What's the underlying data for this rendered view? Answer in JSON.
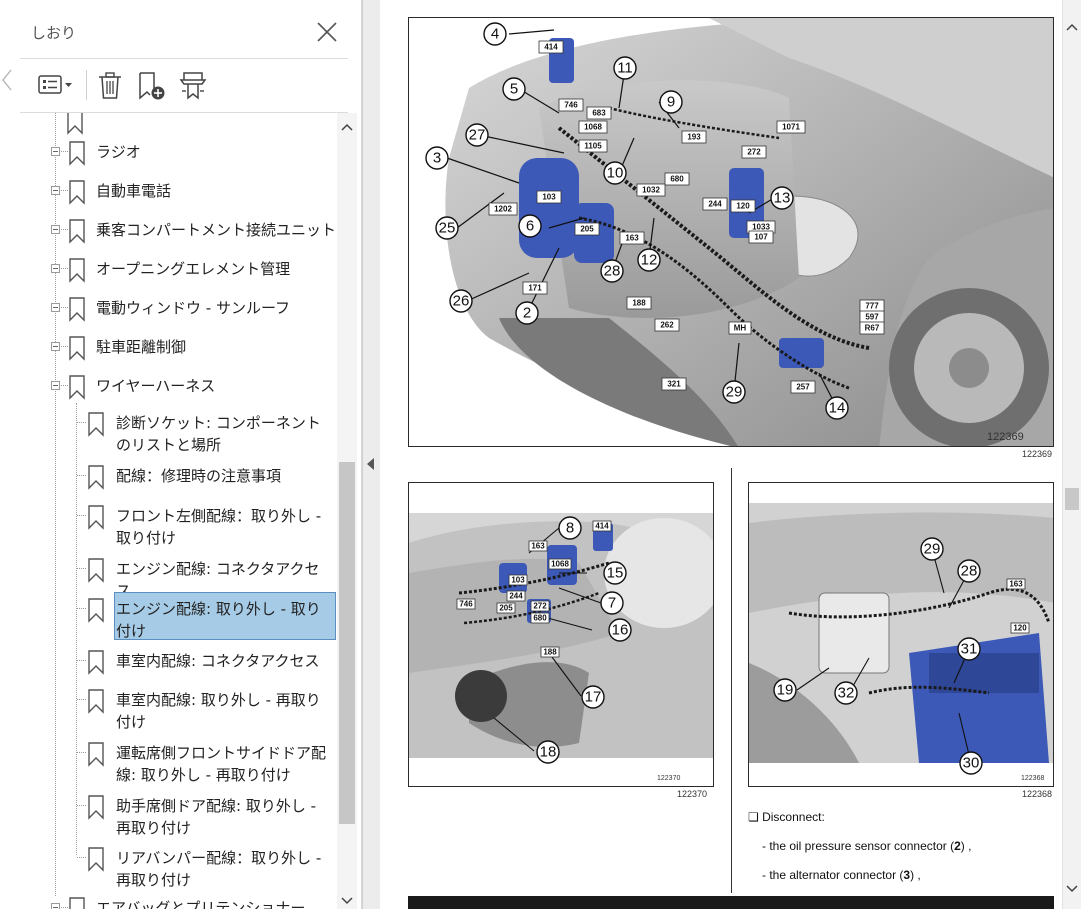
{
  "panel": {
    "title": "しおり",
    "toolbar": {
      "options_icon": "bookmark-options-icon",
      "delete_icon": "trash-icon",
      "new_bookmark_icon": "new-bookmark-icon",
      "find_bookmark_icon": "find-current-bookmark-icon"
    },
    "items": [
      {
        "label": "ラジオ",
        "level": 1
      },
      {
        "label": "自動車電話",
        "level": 1
      },
      {
        "label": "乗客コンパートメント接続ユニット",
        "level": 1
      },
      {
        "label": "オープニングエレメント管理",
        "level": 1
      },
      {
        "label": "電動ウィンドウ - サンルーフ",
        "level": 1
      },
      {
        "label": "駐車距離制御",
        "level": 1
      },
      {
        "label": "ワイヤーハーネス",
        "level": 1,
        "expanded": true
      },
      {
        "label": "診断ソケット: コンポーネントのリストと場所",
        "level": 2
      },
      {
        "label": "配線：修理時の注意事項",
        "level": 2
      },
      {
        "label": "フロント左側配線：取り外し - 取り付け",
        "level": 2
      },
      {
        "label": "エンジン配線: コネクタアクセス",
        "level": 2
      },
      {
        "label": "エンジン配線: 取り外し - 取り付け",
        "level": 2,
        "selected": true
      },
      {
        "label": "車室内配線: コネクタアクセス",
        "level": 2
      },
      {
        "label": "車室内配線: 取り外し - 再取り付け",
        "level": 2
      },
      {
        "label": "運転席側フロントサイドドア配線: 取り外し - 再取り付け",
        "level": 2
      },
      {
        "label": "助手席側ドア配線: 取り外し - 再取り付け",
        "level": 2
      },
      {
        "label": "リアバンパー配線：取り外し - 再取り付け",
        "level": 2
      },
      {
        "label": "エアバッグとプリテンショナー",
        "level": 1
      }
    ]
  },
  "document": {
    "figure_top": {
      "inner_number": "122369",
      "caption": "122369",
      "callouts": [
        "4",
        "5",
        "11",
        "9",
        "27",
        "3",
        "10",
        "13",
        "25",
        "6",
        "28",
        "12",
        "26",
        "2",
        "29",
        "14"
      ],
      "tags": [
        "414",
        "746",
        "683",
        "1068",
        "1105",
        "193",
        "1071",
        "272",
        "1202",
        "103",
        "1032",
        "680",
        "244",
        "120",
        "1033",
        "107",
        "205",
        "163",
        "171",
        "188",
        "262",
        "MH",
        "777",
        "597",
        "R67",
        "321",
        "257"
      ]
    },
    "figure_left": {
      "inner_number": "122370",
      "caption": "122370",
      "callouts": [
        "8",
        "15",
        "7",
        "16",
        "17",
        "18"
      ],
      "tags": [
        "414",
        "163",
        "1068",
        "103",
        "244",
        "272",
        "680",
        "746",
        "205",
        "188"
      ]
    },
    "figure_right": {
      "inner_number": "122368",
      "caption": "122368",
      "callouts": [
        "29",
        "28",
        "31",
        "19",
        "32",
        "30"
      ],
      "tags": [
        "163",
        "120"
      ]
    },
    "instructions": {
      "heading": "Disconnect:",
      "lines": [
        {
          "text": "- the oil pressure sensor connector (",
          "ref": "2",
          "suffix": ") ,"
        },
        {
          "text": "- the alternator connector (",
          "ref": "3",
          "suffix": ") ,"
        }
      ]
    }
  },
  "colors": {
    "selection_bg": "#a6cbe6",
    "selection_border": "#5a8fbf",
    "component_blue": "#3d59b8"
  }
}
